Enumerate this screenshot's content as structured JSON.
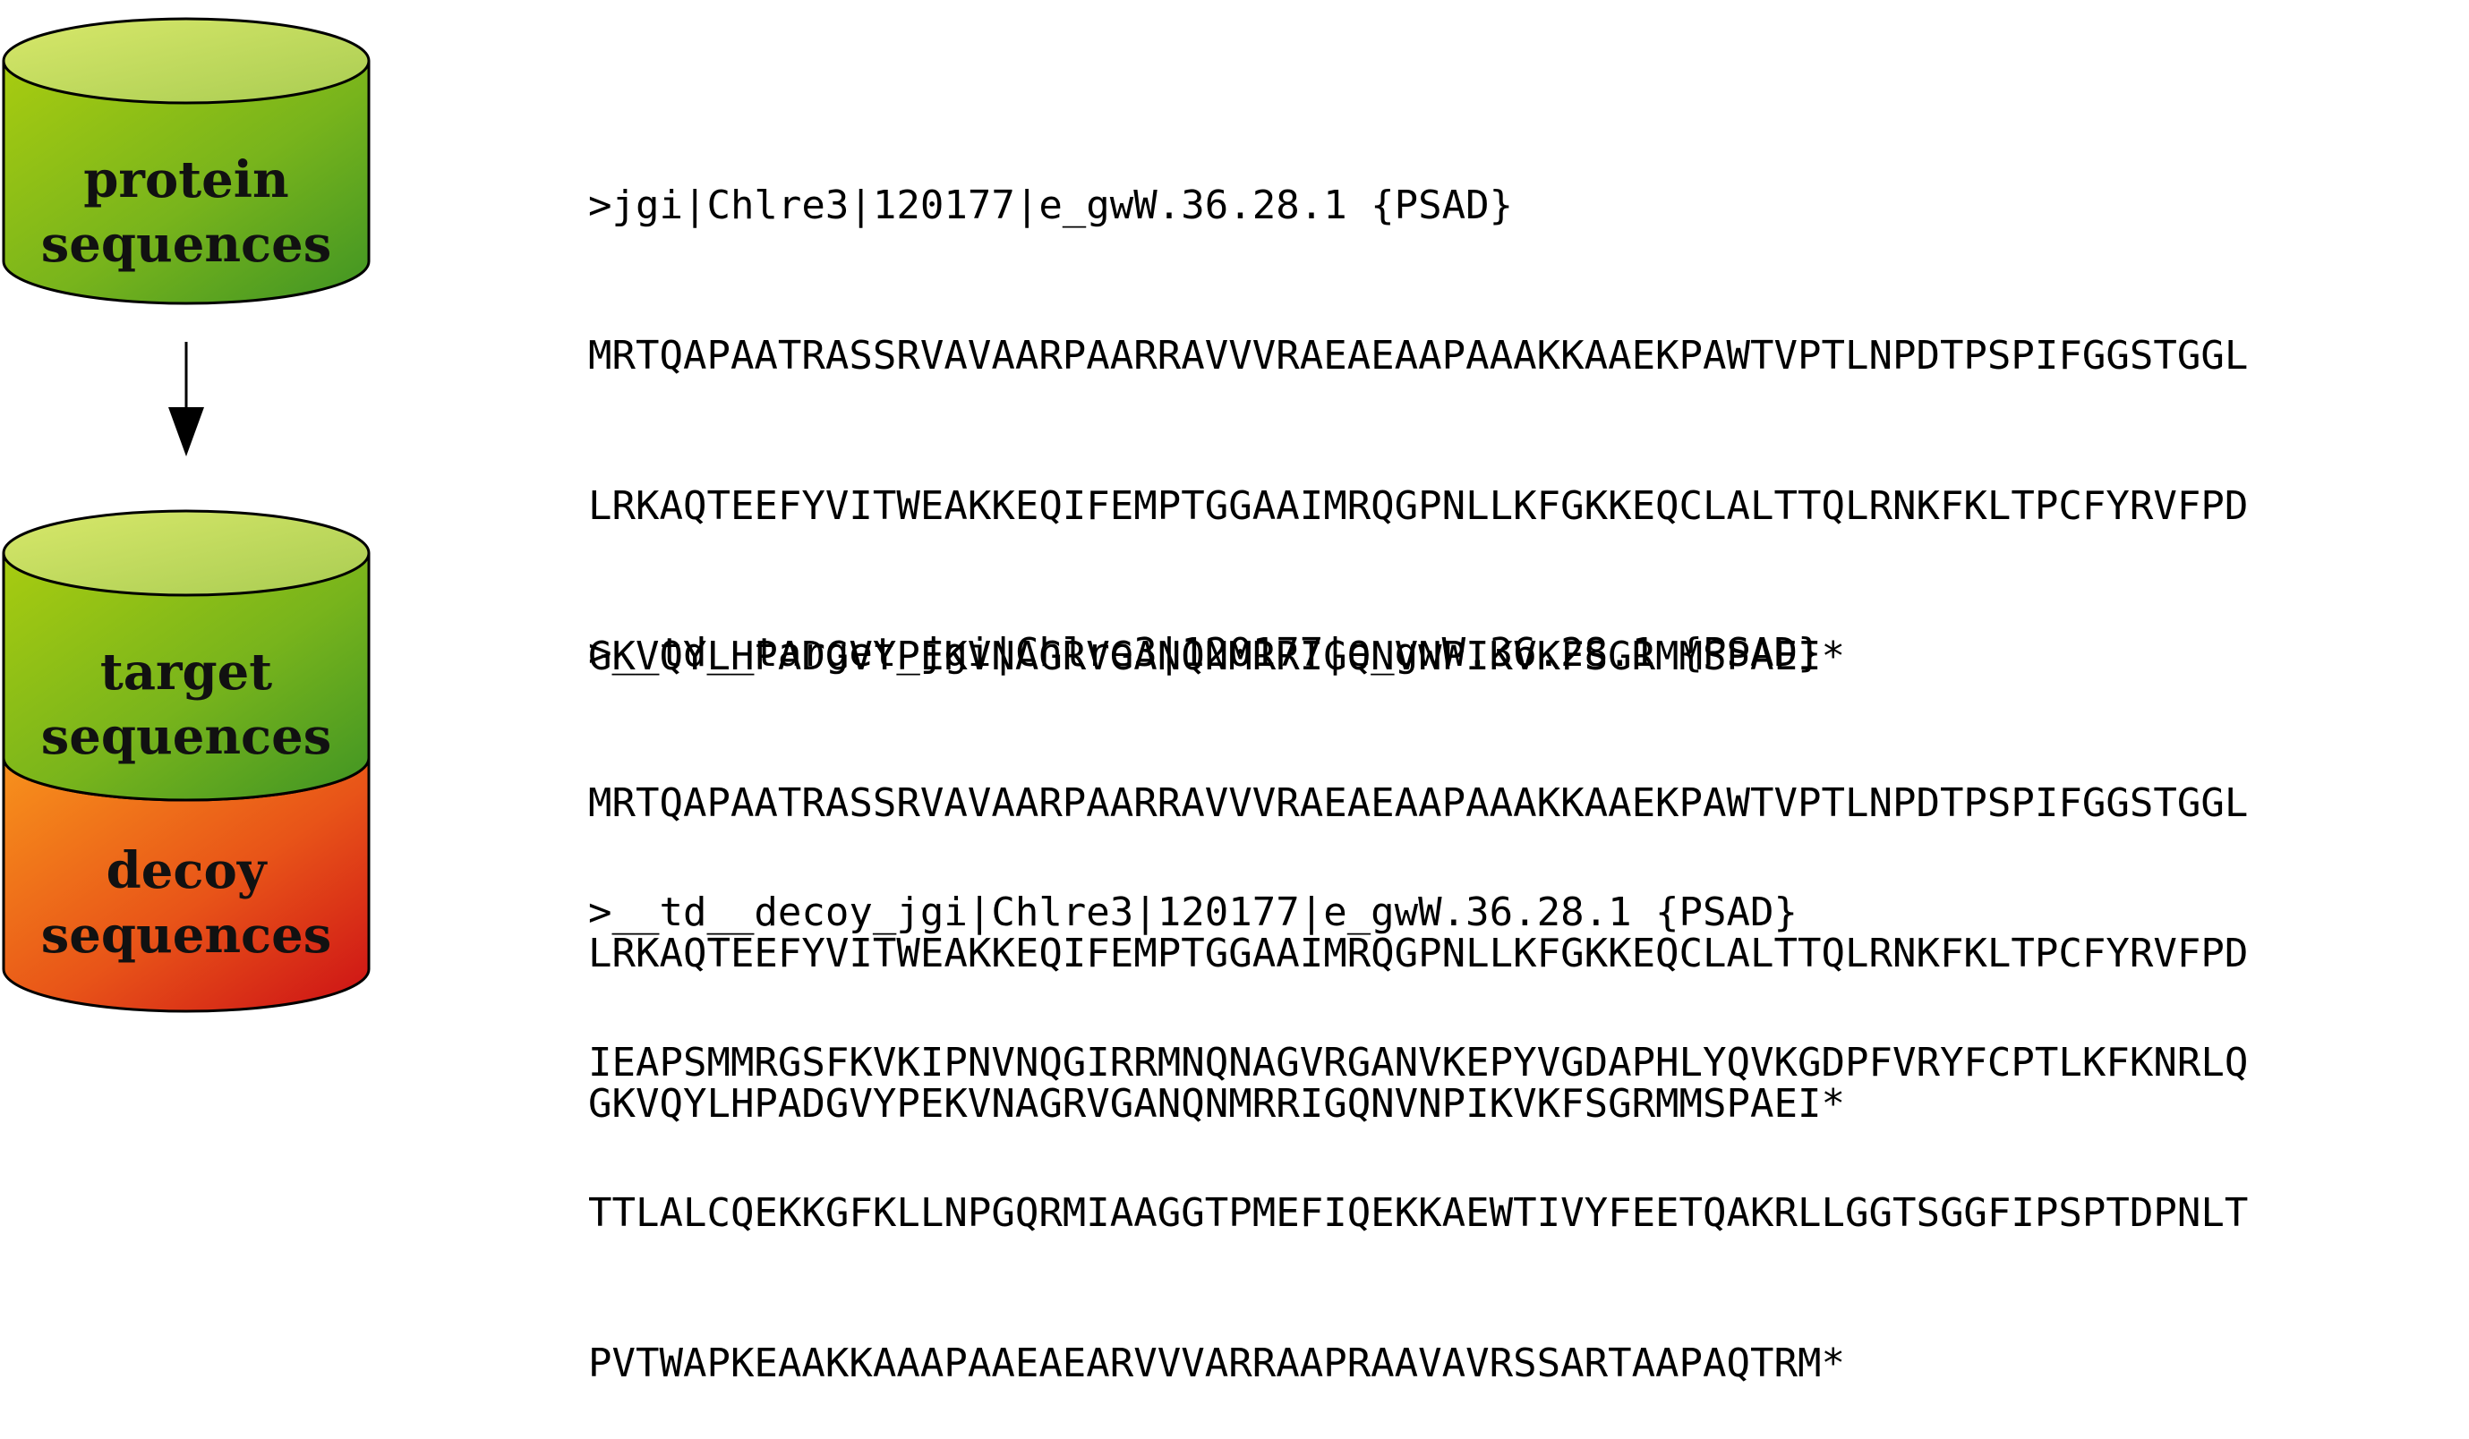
{
  "databases": {
    "protein": {
      "line1": "protein",
      "line2": "sequences"
    },
    "target": {
      "line1": "target",
      "line2": "sequences"
    },
    "decoy": {
      "line1": "decoy",
      "line2": "sequences"
    }
  },
  "colors": {
    "green_light": "#d0e25a",
    "green_dark": "#4a9a20",
    "orange": "#f58220",
    "red": "#d0141a",
    "outline": "#000000"
  },
  "sequences": {
    "protein": {
      "header": ">jgi|Chlre3|120177|e_gwW.36.28.1 {PSAD}",
      "lines": [
        "MRTQAPAATRASSRVAVAARPAARRAVVVRAEAEAAPAAAKKAAEKPAWTVPTLNPDTPSPIFGGSTGGL",
        "LRKAQTEEFYVITWEAKKEQIFEMPTGGAAIMRQGPNLLKFGKKEQCLALTTQLRNKFKLTPCFYRVFPD",
        "GKVQYLHPADGVYPEKVNAGRVGANQNMRRIGQNVNPIKVKFSGRMMSPAEI*"
      ]
    },
    "target": {
      "header": ">__td__target_jgi|Chlre3|120177|e_gwW.36.28.1 {PSAD}",
      "lines": [
        "MRTQAPAATRASSRVAVAARPAARRAVVVRAEAEAAPAAAKKAAEKPAWTVPTLNPDTPSPIFGGSTGGL",
        "LRKAQTEEFYVITWEAKKEQIFEMPTGGAAIMRQGPNLLKFGKKEQCLALTTQLRNKFKLTPCFYRVFPD",
        "GKVQYLHPADGVYPEKVNAGRVGANQNMRRIGQNVNPIKVKFSGRMMSPAEI*"
      ]
    },
    "decoy": {
      "header": ">__td__decoy_jgi|Chlre3|120177|e_gwW.36.28.1 {PSAD}",
      "lines": [
        "IEAPSMMRGSFKVKIPNVNQGIRRMNQNAGVRGANVKEPYVGDAPHLYQVKGDPFVRYFCPTLKFKNRLQ",
        "TTLALCQEKKGFKLLNPGQRMIAAGGTPMEFIQEKKAEWTIVYFEETQAKRLLGGTSGGFIPSPTDPNLT",
        "PVTWAPKEAAKKAAAPAAEAEARVVVARRAAPRAAVAVRSSARTAAPAQTRM*"
      ]
    }
  }
}
